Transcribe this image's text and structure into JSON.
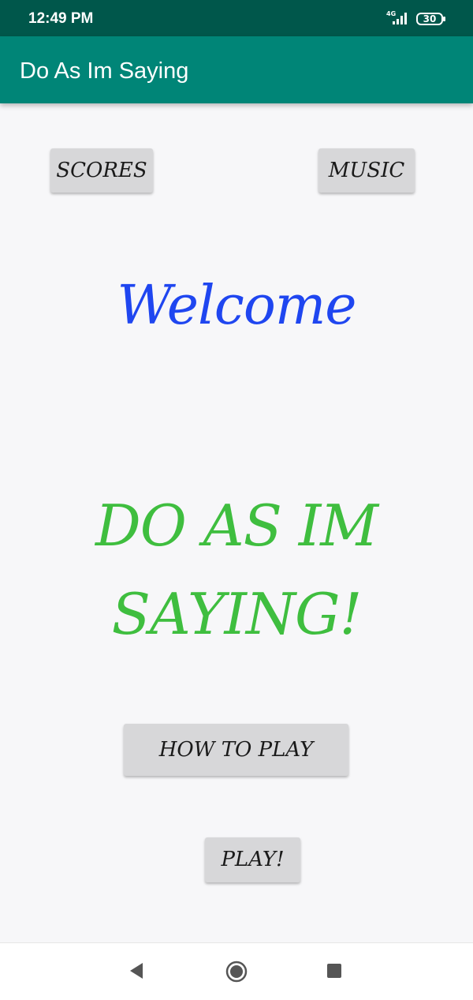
{
  "status_bar": {
    "time": "12:49 PM",
    "network": "4G",
    "battery": "30"
  },
  "app_bar": {
    "title": "Do As Im Saying"
  },
  "buttons": {
    "scores": "SCORES",
    "music": "MUSIC",
    "how_to_play": "HOW TO PLAY",
    "play": "PLAY!"
  },
  "welcome_text": "Welcome",
  "headline": {
    "line1": "DO AS IM",
    "line2": "SAYING!"
  },
  "colors": {
    "status_bar": "#00574b",
    "app_bar": "#008577",
    "welcome": "#1f46f0",
    "headline": "#3fbe3f",
    "button_bg": "#d7d7d9"
  },
  "icons": {
    "signal": "signal-icon",
    "battery": "battery-icon",
    "back": "back-icon",
    "home": "home-icon",
    "recents": "recents-icon"
  }
}
